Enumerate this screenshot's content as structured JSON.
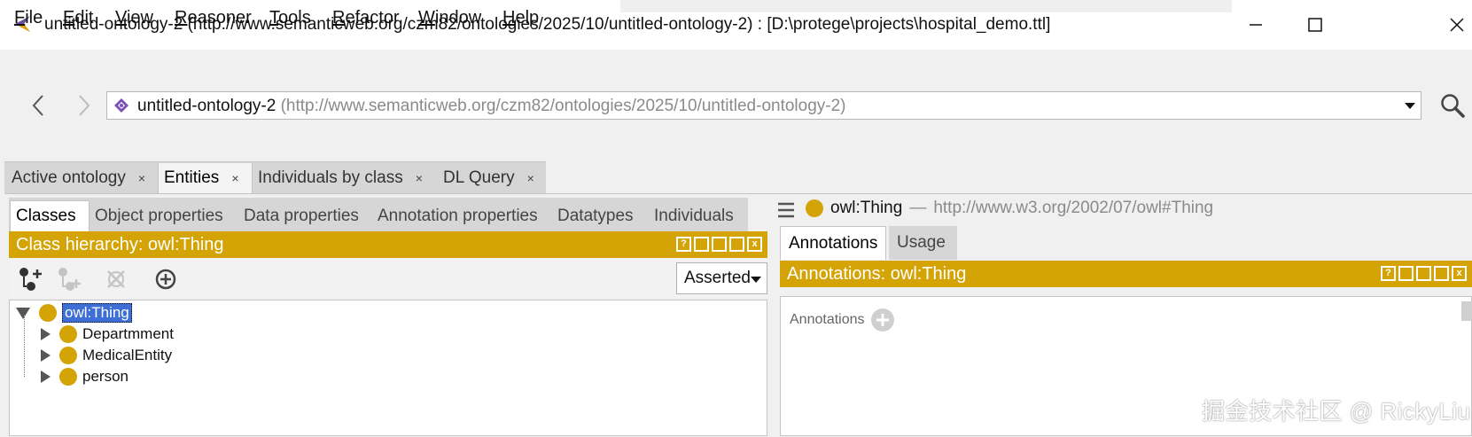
{
  "window": {
    "title": "untitled-ontology-2 (http://www.semanticweb.org/czm82/ontologies/2025/10/untitled-ontology-2)  : [D:\\protege\\projects\\hospital_demo.ttl]",
    "minimize_icon": "minimize-icon",
    "maximize_icon": "maximize-icon",
    "close_icon": "close-icon"
  },
  "menu": [
    {
      "label": "File",
      "mnemonic": "F",
      "rest": "ile"
    },
    {
      "label": "Edit",
      "mnemonic": "E",
      "rest": "dit"
    },
    {
      "label": "View",
      "mnemonic": "V",
      "rest": "iew"
    },
    {
      "label": "Reasoner",
      "mnemonic": "R",
      "rest": "easoner"
    },
    {
      "label": "Tools",
      "mnemonic": "T",
      "rest": "ools"
    },
    {
      "label": "Refactor",
      "mnemonic": "R",
      "rest": "efactor"
    },
    {
      "label": "Window",
      "mnemonic": "W",
      "rest": "indow"
    },
    {
      "label": "Help",
      "mnemonic": "H",
      "rest": "elp"
    }
  ],
  "address": {
    "name": "untitled-ontology-2",
    "iri": "(http://www.semanticweb.org/czm82/ontologies/2025/10/untitled-ontology-2)"
  },
  "tabs": [
    {
      "label": "Active ontology",
      "close": "×"
    },
    {
      "label": "Entities",
      "close": "×"
    },
    {
      "label": "Individuals by class",
      "close": "×"
    },
    {
      "label": "DL Query",
      "close": "×"
    }
  ],
  "subtabs": [
    "Classes",
    "Object properties",
    "Data properties",
    "Annotation properties",
    "Datatypes",
    "Individuals"
  ],
  "class_hierarchy": {
    "title": "Class hierarchy: owl:Thing",
    "mode": "Asserted",
    "root": "owl:Thing",
    "children": [
      "Departmment",
      "MedicalEntity",
      "person"
    ]
  },
  "entity": {
    "name": "owl:Thing",
    "separator": "—",
    "iri": "http://www.w3.org/2002/07/owl#Thing"
  },
  "right_tabs": [
    "Annotations",
    "Usage"
  ],
  "annotations": {
    "title": "Annotations: owl:Thing",
    "label": "Annotations"
  },
  "view_controls": [
    "?",
    "",
    "",
    "",
    "x"
  ],
  "watermark": "掘金技术社区 @ RickyLiu",
  "colors": {
    "gold": "#d4a305",
    "selection": "#3d6fd6"
  }
}
